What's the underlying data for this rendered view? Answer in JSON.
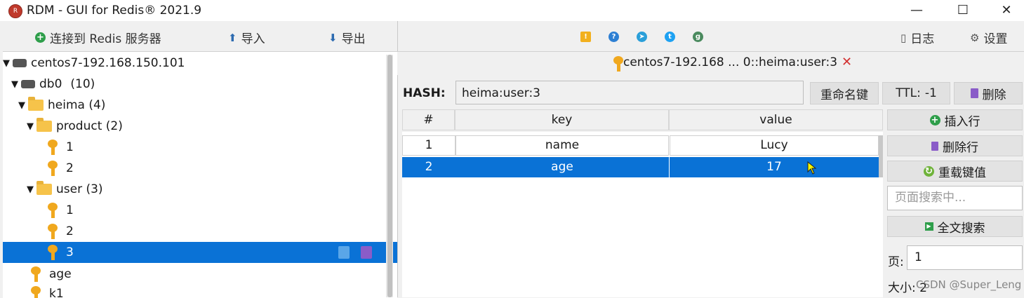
{
  "window": {
    "title": "RDM - GUI for Redis® 2021.9",
    "icon_name": "rdm-logo-icon",
    "minimize": "—",
    "maximize": "☐",
    "close": "✕"
  },
  "toolbar_left": {
    "connect_label": "连接到 Redis 服务器",
    "import_label": "导入",
    "export_label": "导出"
  },
  "toolbar_right": {
    "icons": [
      "warning-icon",
      "help-icon",
      "telegram-icon",
      "twitter-icon",
      "github-icon"
    ],
    "log_label": "日志",
    "settings_label": "设置"
  },
  "tree": {
    "server": "centos7-192.168.150.101",
    "db_label": "db0",
    "db_count": "(10)",
    "folder_heima": "heima (4)",
    "folder_product": "product (2)",
    "product_keys": [
      "1",
      "2"
    ],
    "folder_user": "user (3)",
    "user_keys": [
      "1",
      "2",
      "3"
    ],
    "root_keys": [
      "age",
      "k1"
    ],
    "selected_key": "3"
  },
  "tab": {
    "label": "centos7-192.168 ... 0::heima:user:3",
    "close": "✕"
  },
  "key_editor": {
    "type_label": "HASH:",
    "key_name": "heima:user:3",
    "rename_label": "重命名键",
    "ttl_label": "TTL:",
    "ttl_value": "-1",
    "delete_label": "删除"
  },
  "grid": {
    "headers": [
      "#",
      "key",
      "value"
    ],
    "rows": [
      {
        "index": "1",
        "key": "name",
        "value": "Lucy"
      },
      {
        "index": "2",
        "key": "age",
        "value": "17"
      }
    ],
    "selected_row": 2
  },
  "side_panel": {
    "insert_row": "插入行",
    "delete_row": "删除行",
    "reload_value": "重载键值",
    "search_placeholder": "页面搜索中...",
    "fulltext_search": "全文搜索",
    "page_label": "页:",
    "page_value": "1",
    "size_label": "大小:",
    "size_value": "2"
  },
  "watermark": "CSDN @Super_Leng",
  "colors": {
    "selection": "#0a72d6",
    "key_icon": "#f0a81e",
    "folder": "#f6c34a",
    "add_green": "#2e9e4a",
    "delete_purple": "#8a5cc8",
    "close_red": "#d23030"
  }
}
